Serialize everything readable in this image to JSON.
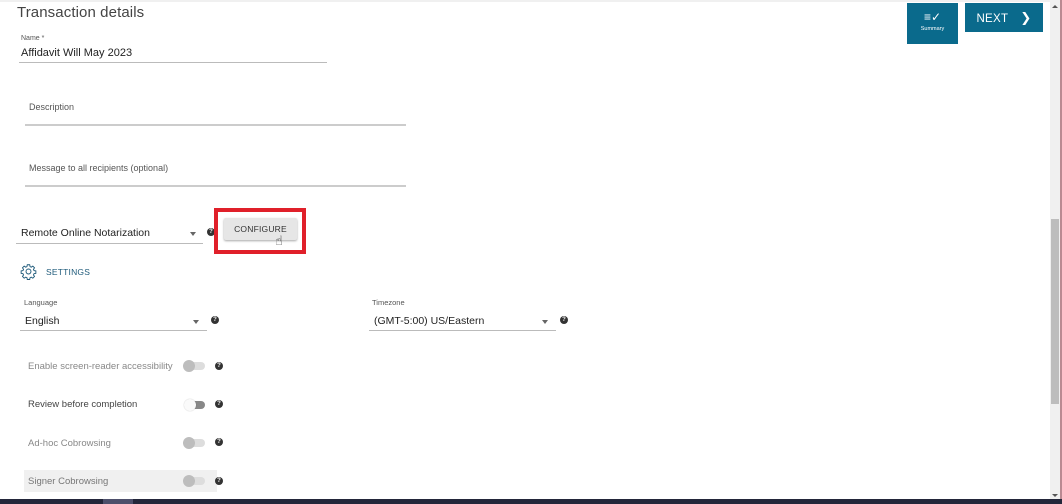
{
  "page": {
    "title": "Transaction details"
  },
  "header_buttons": {
    "summary": {
      "label": "Summary",
      "icon": "checklist-icon"
    },
    "next": {
      "label": "NEXT",
      "icon": "chevron-right-icon"
    }
  },
  "form": {
    "name": {
      "label": "Name *",
      "value": "Affidavit Will May 2023"
    },
    "description": {
      "placeholder": "Description"
    },
    "message": {
      "placeholder": "Message to all recipients (optional)"
    },
    "transaction_type": {
      "value": "Remote Online Notarization"
    },
    "configure_button": "CONFIGURE"
  },
  "settings": {
    "label": "SETTINGS",
    "language": {
      "label": "Language",
      "value": "English"
    },
    "timezone": {
      "label": "Timezone",
      "value": "(GMT-5:00) US/Eastern"
    },
    "toggles": [
      {
        "label": "Enable screen-reader accessibility",
        "state": "off",
        "disabled": true
      },
      {
        "label": "Review before completion",
        "state": "off",
        "disabled": false
      },
      {
        "label": "Ad-hoc Cobrowsing",
        "state": "off",
        "disabled": true
      },
      {
        "label": "Signer Cobrowsing",
        "state": "off",
        "disabled": true
      }
    ]
  },
  "help_glyph": "?",
  "colors": {
    "primary": "#0a6a8c",
    "highlight": "#e0202a",
    "settings_link": "#1e5a7a"
  }
}
